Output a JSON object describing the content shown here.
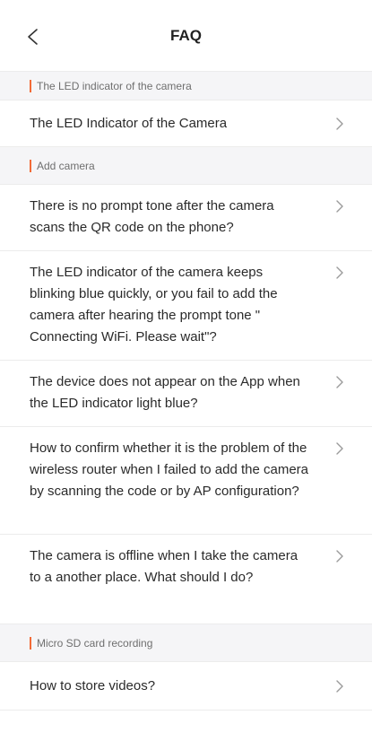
{
  "header": {
    "title": "FAQ"
  },
  "sections": [
    {
      "title": "The LED indicator of the camera",
      "items": [
        {
          "question": "The LED Indicator of the Camera"
        }
      ]
    },
    {
      "title": "Add camera",
      "items": [
        {
          "question": "There is no prompt tone after the camera scans the QR code on the phone?"
        },
        {
          "question": "The LED indicator of the camera keeps blinking blue quickly, or you fail to add the camera after hearing the prompt tone \" Connecting WiFi. Please wait\"?"
        },
        {
          "question": "The device does not appear on the App when the LED indicator light blue?"
        },
        {
          "question": "How to confirm whether it is the problem of the wireless router when I failed to add the camera by scanning the code or by AP configuration?"
        },
        {
          "question": "The camera is offline when I take the camera to a another place. What should I do?"
        }
      ]
    },
    {
      "title": "Micro SD card recording",
      "items": [
        {
          "question": "How to store videos?"
        }
      ]
    }
  ],
  "colors": {
    "accent": "#f26a36",
    "section_bg": "#f5f5f7",
    "divider": "#ececec"
  }
}
